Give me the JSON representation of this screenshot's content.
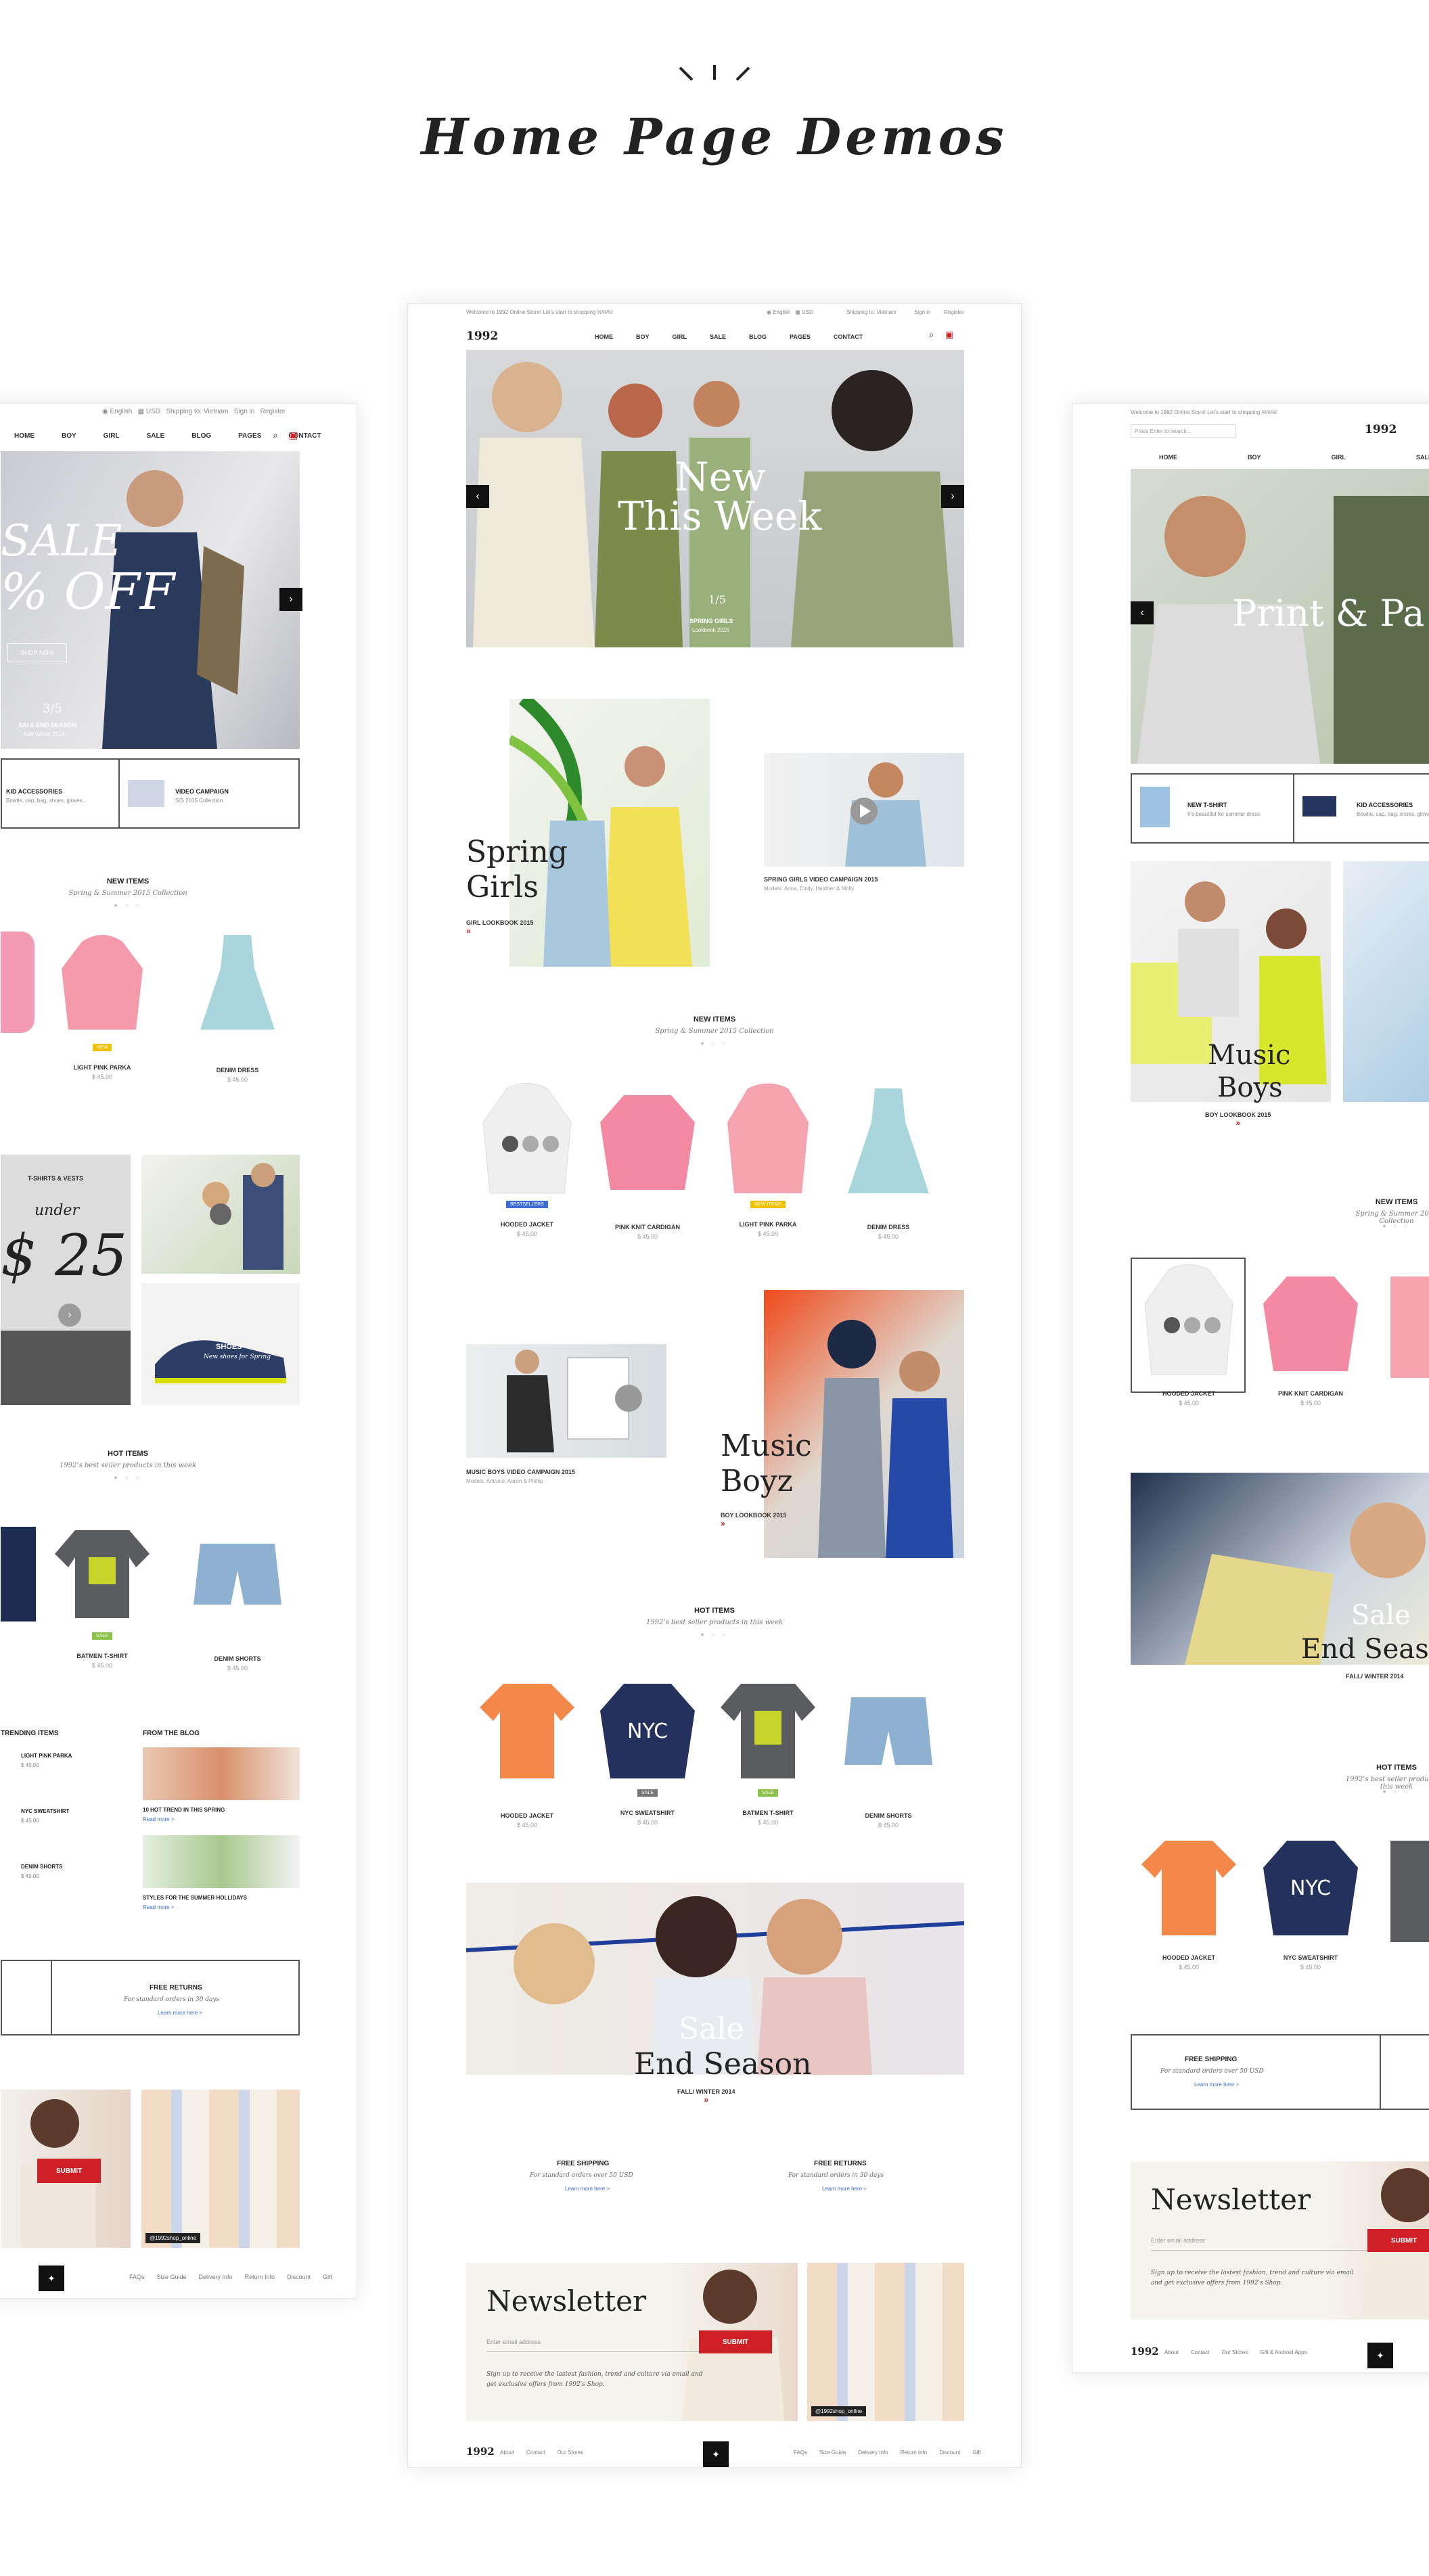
{
  "page_title": "Home Page Demos",
  "colors": {
    "accent": "#d02027",
    "dark": "#111111",
    "blue_badge": "#3d6bd6",
    "yellow_badge": "#f2c200",
    "green_badge": "#8bc34a"
  },
  "center": {
    "topbar": {
      "welcome": "Welcome to 1992 Online Store! Let’s start to shopping %%%!",
      "language": "English",
      "currency": "USD",
      "shipping": "Shipping to: Vietnam",
      "signin": "Sign in",
      "register": "Register"
    },
    "logo": "1992",
    "nav": [
      "HOME",
      "BOY",
      "GIRL",
      "SALE",
      "BLOG",
      "PAGES",
      "CONTACT"
    ],
    "slider": {
      "title_line1": "New",
      "title_line2": "This Week",
      "counter": "1/5",
      "subtitle": "SPRING GIRLS",
      "collection": "Lookbook 2015"
    },
    "spring": {
      "title_line1": "Spring",
      "title_line2": "Girls",
      "caption": "GIRL LOOKBOOK 2015"
    },
    "video": {
      "caption": "SPRING GIRLS VIDEO CAMPAIGN 2015",
      "sub": "Models: Anna, Emily, Heather & Molly"
    },
    "new_items": {
      "title": "NEW ITEMS",
      "subtitle": "Spring & Summer 2015 Collection"
    },
    "products1": [
      {
        "name": "HOODED JACKET",
        "price": "$ 45.00",
        "badge": "BESTSELLERS"
      },
      {
        "name": "PINK KNIT CARDIGAN",
        "price": "$ 45.00",
        "badge": ""
      },
      {
        "name": "LIGHT PINK PARKA",
        "price": "$ 45.00",
        "badge": "NEW ITEMS"
      },
      {
        "name": "DENIM DRESS",
        "price": "$ 45.00",
        "badge": ""
      }
    ],
    "music_video": {
      "caption": "MUSIC BOYS VIDEO CAMPAIGN 2015",
      "sub": "Models: Antonio, Aaron & Phillip"
    },
    "music": {
      "title_line1": "Music",
      "title_line2": "Boyz",
      "caption": "BOY LOOKBOOK 2015"
    },
    "hot_items": {
      "title": "HOT ITEMS",
      "subtitle": "1992’s best seller products in this week"
    },
    "products2": [
      {
        "name": "HOODED JACKET",
        "price": "$ 45.00"
      },
      {
        "name": "NYC SWEATSHIRT",
        "price": "$ 45.00"
      },
      {
        "name": "BATMEN T-SHIRT",
        "price": "$ 45.00"
      },
      {
        "name": "DENIM SHORTS",
        "price": "$ 45.00"
      }
    ],
    "sale": {
      "title_line1": "Sale",
      "title_line2": "End Season",
      "caption": "FALL/ WINTER 2014"
    },
    "shipping": {
      "title": "FREE SHIPPING",
      "sub": "For standard orders over 50 USD",
      "link": "Learn more here >"
    },
    "returns": {
      "title": "FREE RETURNS",
      "sub": "For standard orders in 30 days",
      "link": "Learn more here >"
    },
    "newsletter": {
      "title": "Newsletter",
      "placeholder": "Enter email address",
      "button": "SUBMIT",
      "text": "Sign up to receive the lastest fashion, trend and culture via email and get exclusive offers from 1992's Shop."
    },
    "instagram": "@1992shop_online",
    "footer": {
      "logo": "1992",
      "links": [
        "About",
        "Contact",
        "Our Stores"
      ],
      "links2": [
        "FAQs",
        "Size Guide",
        "Delivery Info",
        "Return Info",
        "Discount",
        "Gift"
      ]
    }
  },
  "left": {
    "nav": [
      "HOME",
      "BOY",
      "GIRL",
      "SALE",
      "BLOG",
      "PAGES",
      "CONTACT"
    ],
    "hero": {
      "line1": "SALE",
      "line2": "% OFF",
      "button": "SHOP NOW",
      "counter": "3/5",
      "subtitle": "SALE END SEASON",
      "sub2": "Fall/ Winter 2014"
    },
    "features": [
      {
        "title": "KID ACCESSORIES",
        "sub": "Bowtie, cap, bag, shoes, gloves..."
      },
      {
        "title": "VIDEO CAMPAIGN",
        "sub": "S/S 2015 Collection"
      }
    ],
    "new_items": {
      "title": "NEW ITEMS",
      "subtitle": "Spring & Summer 2015 Collection"
    },
    "products": [
      {
        "name": "LIGHT PINK PARKA",
        "price": "$ 45.00"
      },
      {
        "name": "DENIM DRESS",
        "price": "$ 45.00"
      }
    ],
    "promo": {
      "title": "T-SHIRTS & VESTS",
      "under": "under",
      "price": "$ 25",
      "shoes_title": "SHOES",
      "shoes_sub": "New shoes for Spring"
    },
    "hot_items": {
      "title": "HOT ITEMS",
      "subtitle": "1992’s best seller products in this week"
    },
    "products2": [
      {
        "name": "BATMEN T-SHIRT",
        "price": "$ 45.00"
      },
      {
        "name": "DENIM SHORTS",
        "price": "$ 45.00"
      }
    ],
    "trending": {
      "title": "TRENDING ITEMS",
      "items": [
        {
          "name": "LIGHT PINK PARKA",
          "price": "$ 45.00"
        },
        {
          "name": "NYC SWEATSHIRT",
          "price": "$ 45.00"
        },
        {
          "name": "DENIM SHORTS",
          "price": "$ 45.00"
        }
      ]
    },
    "blog": {
      "title": "FROM THE BLOG",
      "posts": [
        "10 HOT TREND IN THIS SPRING",
        "STYLES FOR THE SUMMER HOLLIDAYS"
      ],
      "read_more": "Read more >"
    },
    "returns": {
      "title": "FREE RETURNS",
      "sub": "For standard orders in 30 days",
      "link": "Learn more here >"
    },
    "submit": "SUBMIT",
    "instagram": "@1992shop_online",
    "footer_links": [
      "FAQs",
      "Size Guide",
      "Delivery Info",
      "Return Info",
      "Discount",
      "Gift"
    ]
  },
  "right": {
    "search_placeholder": "Press Enter to search...",
    "logo": "1992",
    "nav": [
      "HOME",
      "BOY",
      "GIRL",
      "SALE"
    ],
    "hero": {
      "title": "Print & Pa"
    },
    "features": [
      {
        "title": "NEW T-SHIRT",
        "sub": "It’s beautiful for summer dress"
      },
      {
        "title": "KID ACCESSORIES",
        "sub": "Bowtie, cap, bag, shoes, gloves..."
      }
    ],
    "music": {
      "title_line1": "Music",
      "title_line2": "Boys",
      "caption": "BOY LOOKBOOK 2015"
    },
    "new_items": {
      "title": "NEW ITEMS",
      "subtitle": "Spring & Summer 2015 Collection"
    },
    "products": [
      {
        "name": "HOODED JACKET",
        "price": "$ 45.00"
      },
      {
        "name": "PINK KNIT CARDIGAN",
        "price": "$ 45.00"
      }
    ],
    "sale": {
      "title_line1": "Sale",
      "title_line2": "End Seaso",
      "caption": "FALL/ WINTER 2014"
    },
    "hot_items": {
      "title": "HOT ITEMS",
      "subtitle": "1992’s best seller products in this week"
    },
    "products2": [
      {
        "name": "HOODED JACKET",
        "price": "$ 45.00"
      },
      {
        "name": "NYC SWEATSHIRT",
        "price": "$ 45.00"
      }
    ],
    "shipping": {
      "title": "FREE SHIPPING",
      "sub": "For standard orders over 50 USD",
      "link": "Learn more here >"
    },
    "newsletter": {
      "title": "Newsletter",
      "placeholder": "Enter email address",
      "button": "SUBMIT",
      "text": "Sign up to receive the lastest fashion, trend and culture via email and get exclusive offers from 1992's Shop."
    },
    "footer": {
      "logo": "1992",
      "links": [
        "About",
        "Contact",
        "Our Stores",
        "Gift & Android Apps"
      ]
    }
  }
}
